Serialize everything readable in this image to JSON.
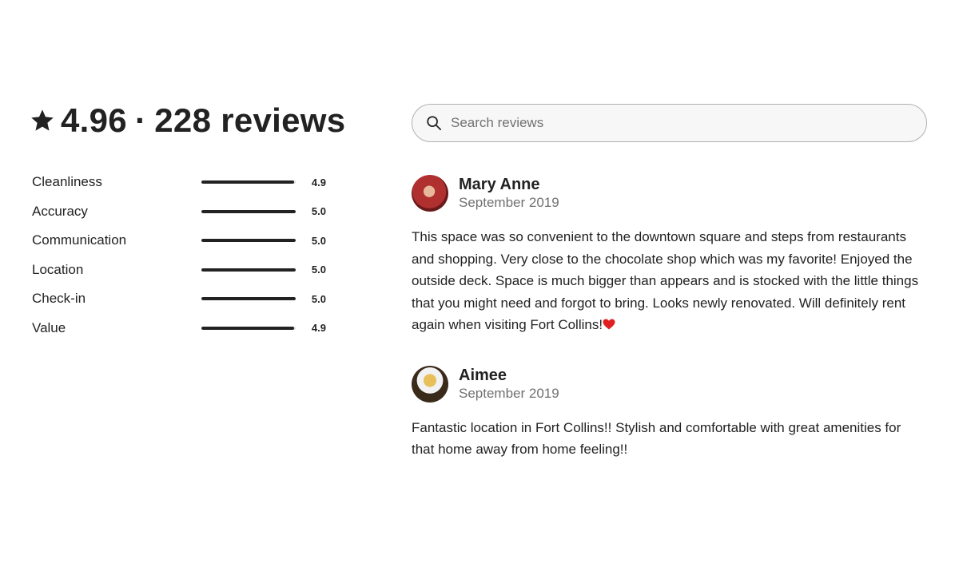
{
  "summary": {
    "rating": "4.96",
    "separator": "·",
    "reviews_label": "228 reviews",
    "icon": "star-icon"
  },
  "categories": [
    {
      "label": "Cleanliness",
      "value": "4.9",
      "fraction": 0.98
    },
    {
      "label": "Accuracy",
      "value": "5.0",
      "fraction": 1.0
    },
    {
      "label": "Communication",
      "value": "5.0",
      "fraction": 1.0
    },
    {
      "label": "Location",
      "value": "5.0",
      "fraction": 1.0
    },
    {
      "label": "Check-in",
      "value": "5.0",
      "fraction": 1.0
    },
    {
      "label": "Value",
      "value": "4.9",
      "fraction": 0.98
    }
  ],
  "search": {
    "placeholder": "Search reviews",
    "value": "",
    "icon": "search-icon"
  },
  "reviews": [
    {
      "name": "Mary Anne",
      "date": "September 2019",
      "text": "This space was so convenient to the downtown square and steps from restaurants and shopping. Very close to the chocolate shop which was my favorite! Enjoyed the outside deck. Space is much bigger than appears and is stocked with the little things that you might need and forgot to bring. Looks newly renovated. Will definitely rent again when visiting Fort Collins!",
      "emoji": "heart-icon"
    },
    {
      "name": "Aimee",
      "date": "September 2019",
      "text": "Fantastic location in Fort Collins!! Stylish and comfortable with great amenities for that home away from home feeling!!"
    }
  ],
  "colors": {
    "text": "#222222",
    "secondary_text": "#717171",
    "bar_track": "#dddddd",
    "bar_fill": "#222222",
    "heart": "#e02020"
  }
}
